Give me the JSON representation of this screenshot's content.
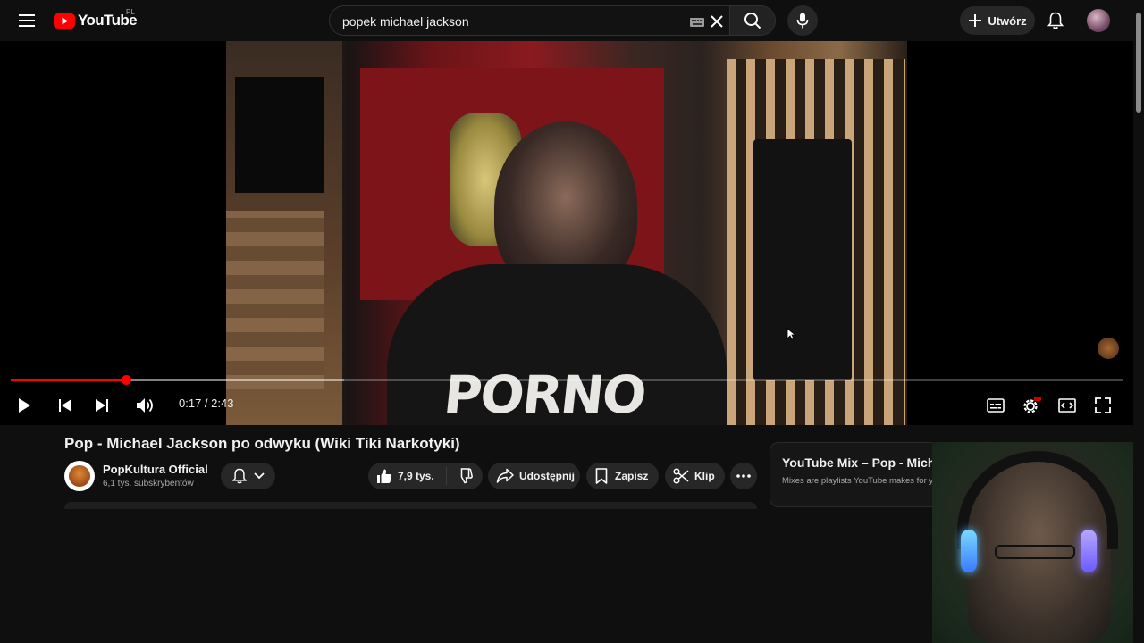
{
  "header": {
    "logo_text": "YouTube",
    "country_code": "PL",
    "search_value": "popek michael jackson",
    "create_label": "Utwórz"
  },
  "player": {
    "current_time": "0:17",
    "duration": "2:43",
    "time_display": "0:17 / 2:43",
    "progress_fraction": 0.104,
    "buffered_fraction": 0.3,
    "shirt_text": "PORNO"
  },
  "video": {
    "title": "Pop - Michael Jackson po odwyku (Wiki Tiki Narkotyki)",
    "channel_name": "PopKultura Official",
    "subscribers": "6,1 tys. subskrybentów",
    "likes": "7,9 tys.",
    "share_label": "Udostępnij",
    "save_label": "Zapisz",
    "clip_label": "Klip"
  },
  "mix": {
    "title": "YouTube Mix – Pop - Michael Jackson po odwyku",
    "subtitle": "Mixes are playlists YouTube makes for you"
  },
  "colors": {
    "accent": "#ff0000",
    "background": "#0f0f0f",
    "pill": "#272727"
  }
}
